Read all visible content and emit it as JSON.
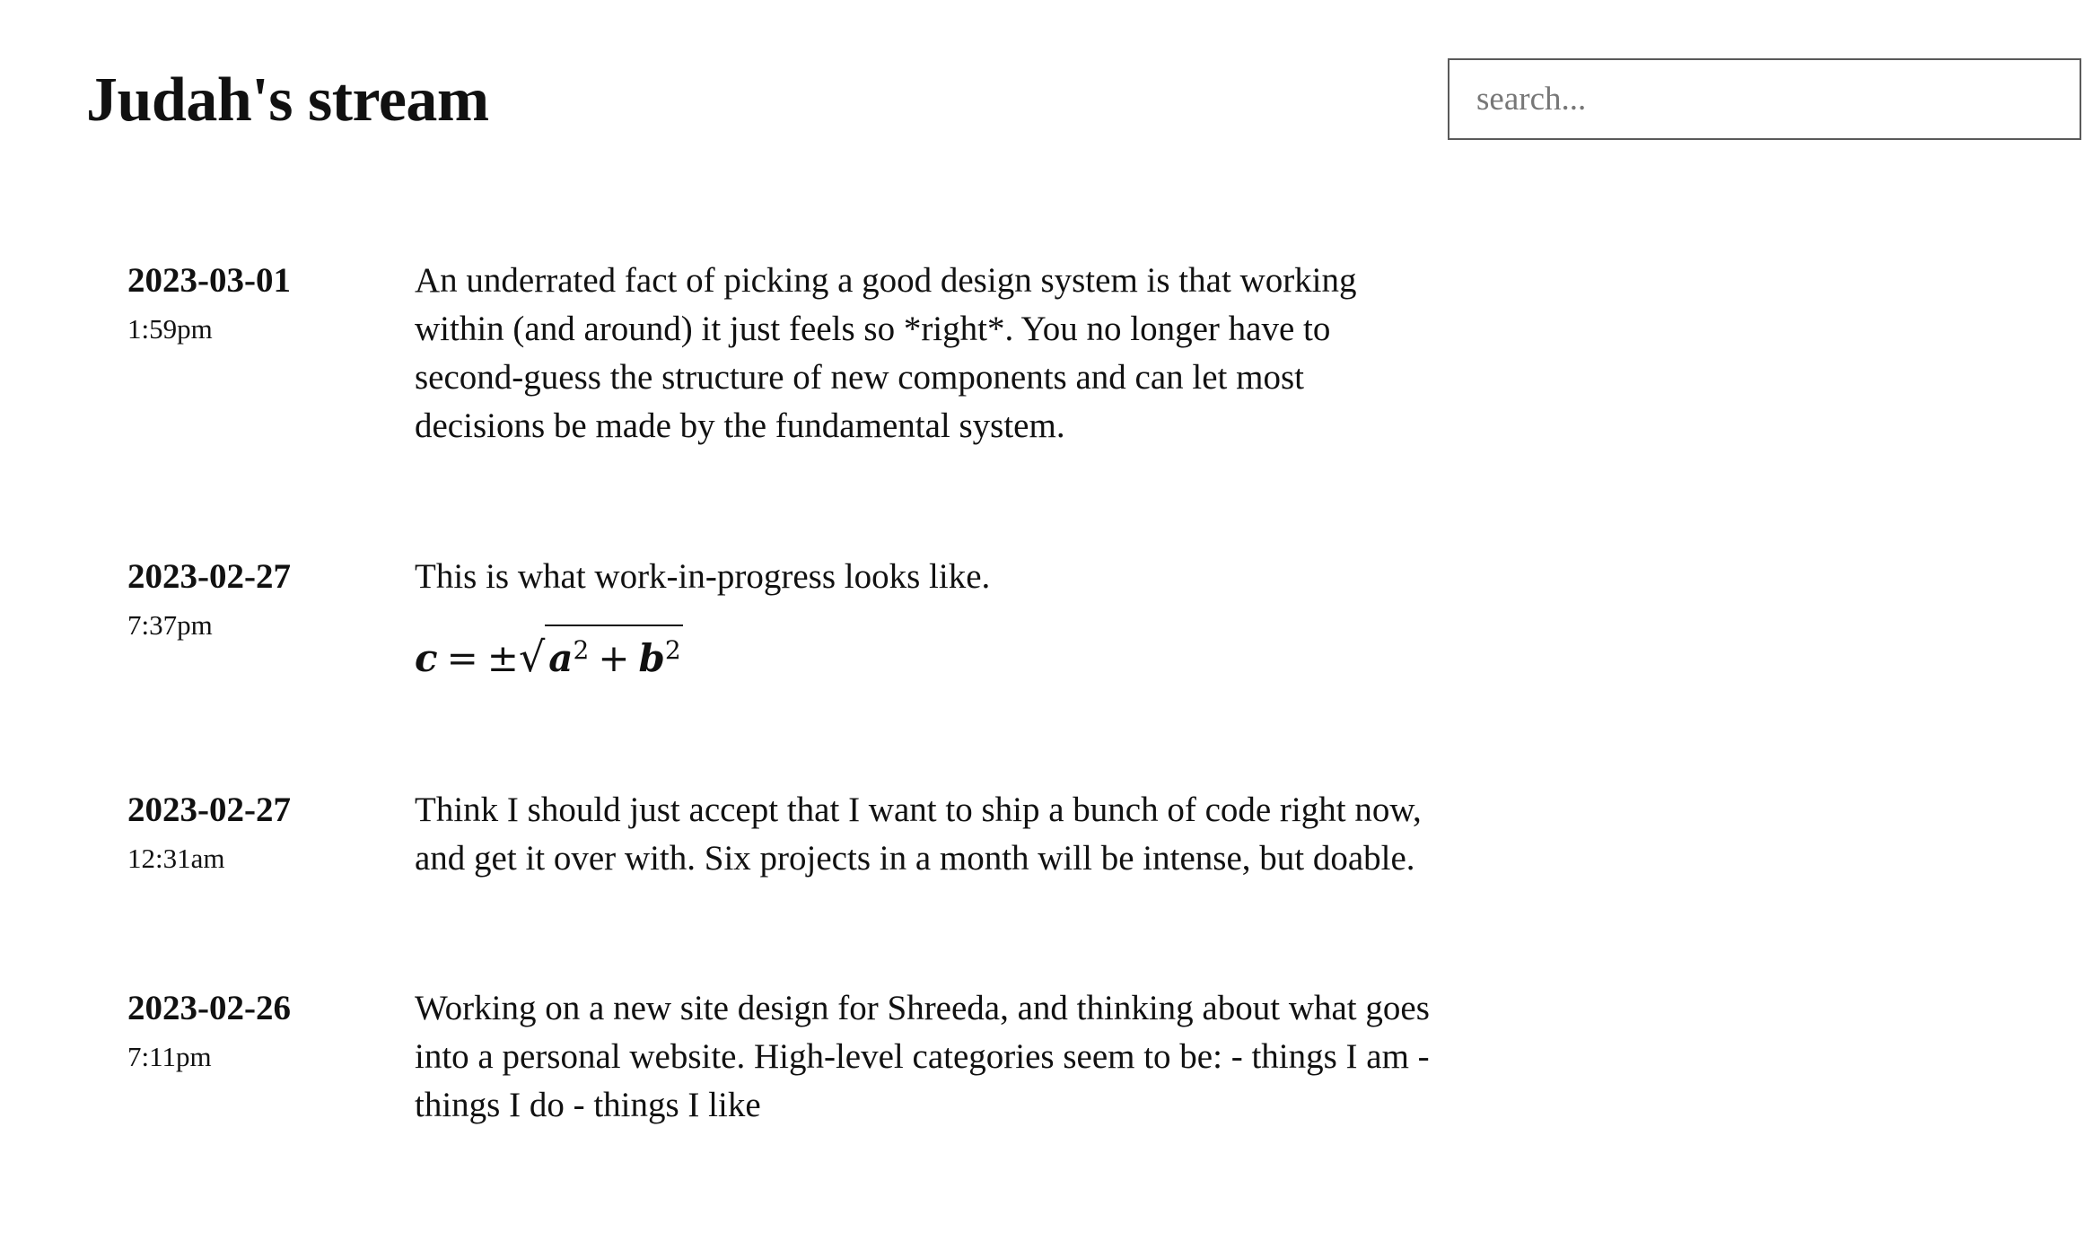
{
  "header": {
    "title": "Judah's stream",
    "search_placeholder": "search..."
  },
  "entries": [
    {
      "date": "2023-03-01",
      "time": "1:59pm",
      "text": "An underrated fact of picking a good design system is that working within (and around) it just feels so *right*. You no longer have to second-guess the structure of new components and can let most decisions be made by the fundamental system."
    },
    {
      "date": "2023-02-27",
      "time": "7:37pm",
      "text": "This is what work-in-progress looks like.",
      "formula": {
        "lhs": "c",
        "eq": "=",
        "pm": "±",
        "radical": "√",
        "a": "a",
        "a_exp": "2",
        "plus": "+",
        "b": "b",
        "b_exp": "2"
      }
    },
    {
      "date": "2023-02-27",
      "time": "12:31am",
      "text": "Think I should just accept that I want to ship a bunch of code right now, and get it over with. Six projects in a month will be intense, but doable."
    },
    {
      "date": "2023-02-26",
      "time": "7:11pm",
      "text": "Working on a new site design for Shreeda, and thinking about what goes into a personal website. High-level categories seem to be: - things I am - things I do - things I like"
    }
  ]
}
